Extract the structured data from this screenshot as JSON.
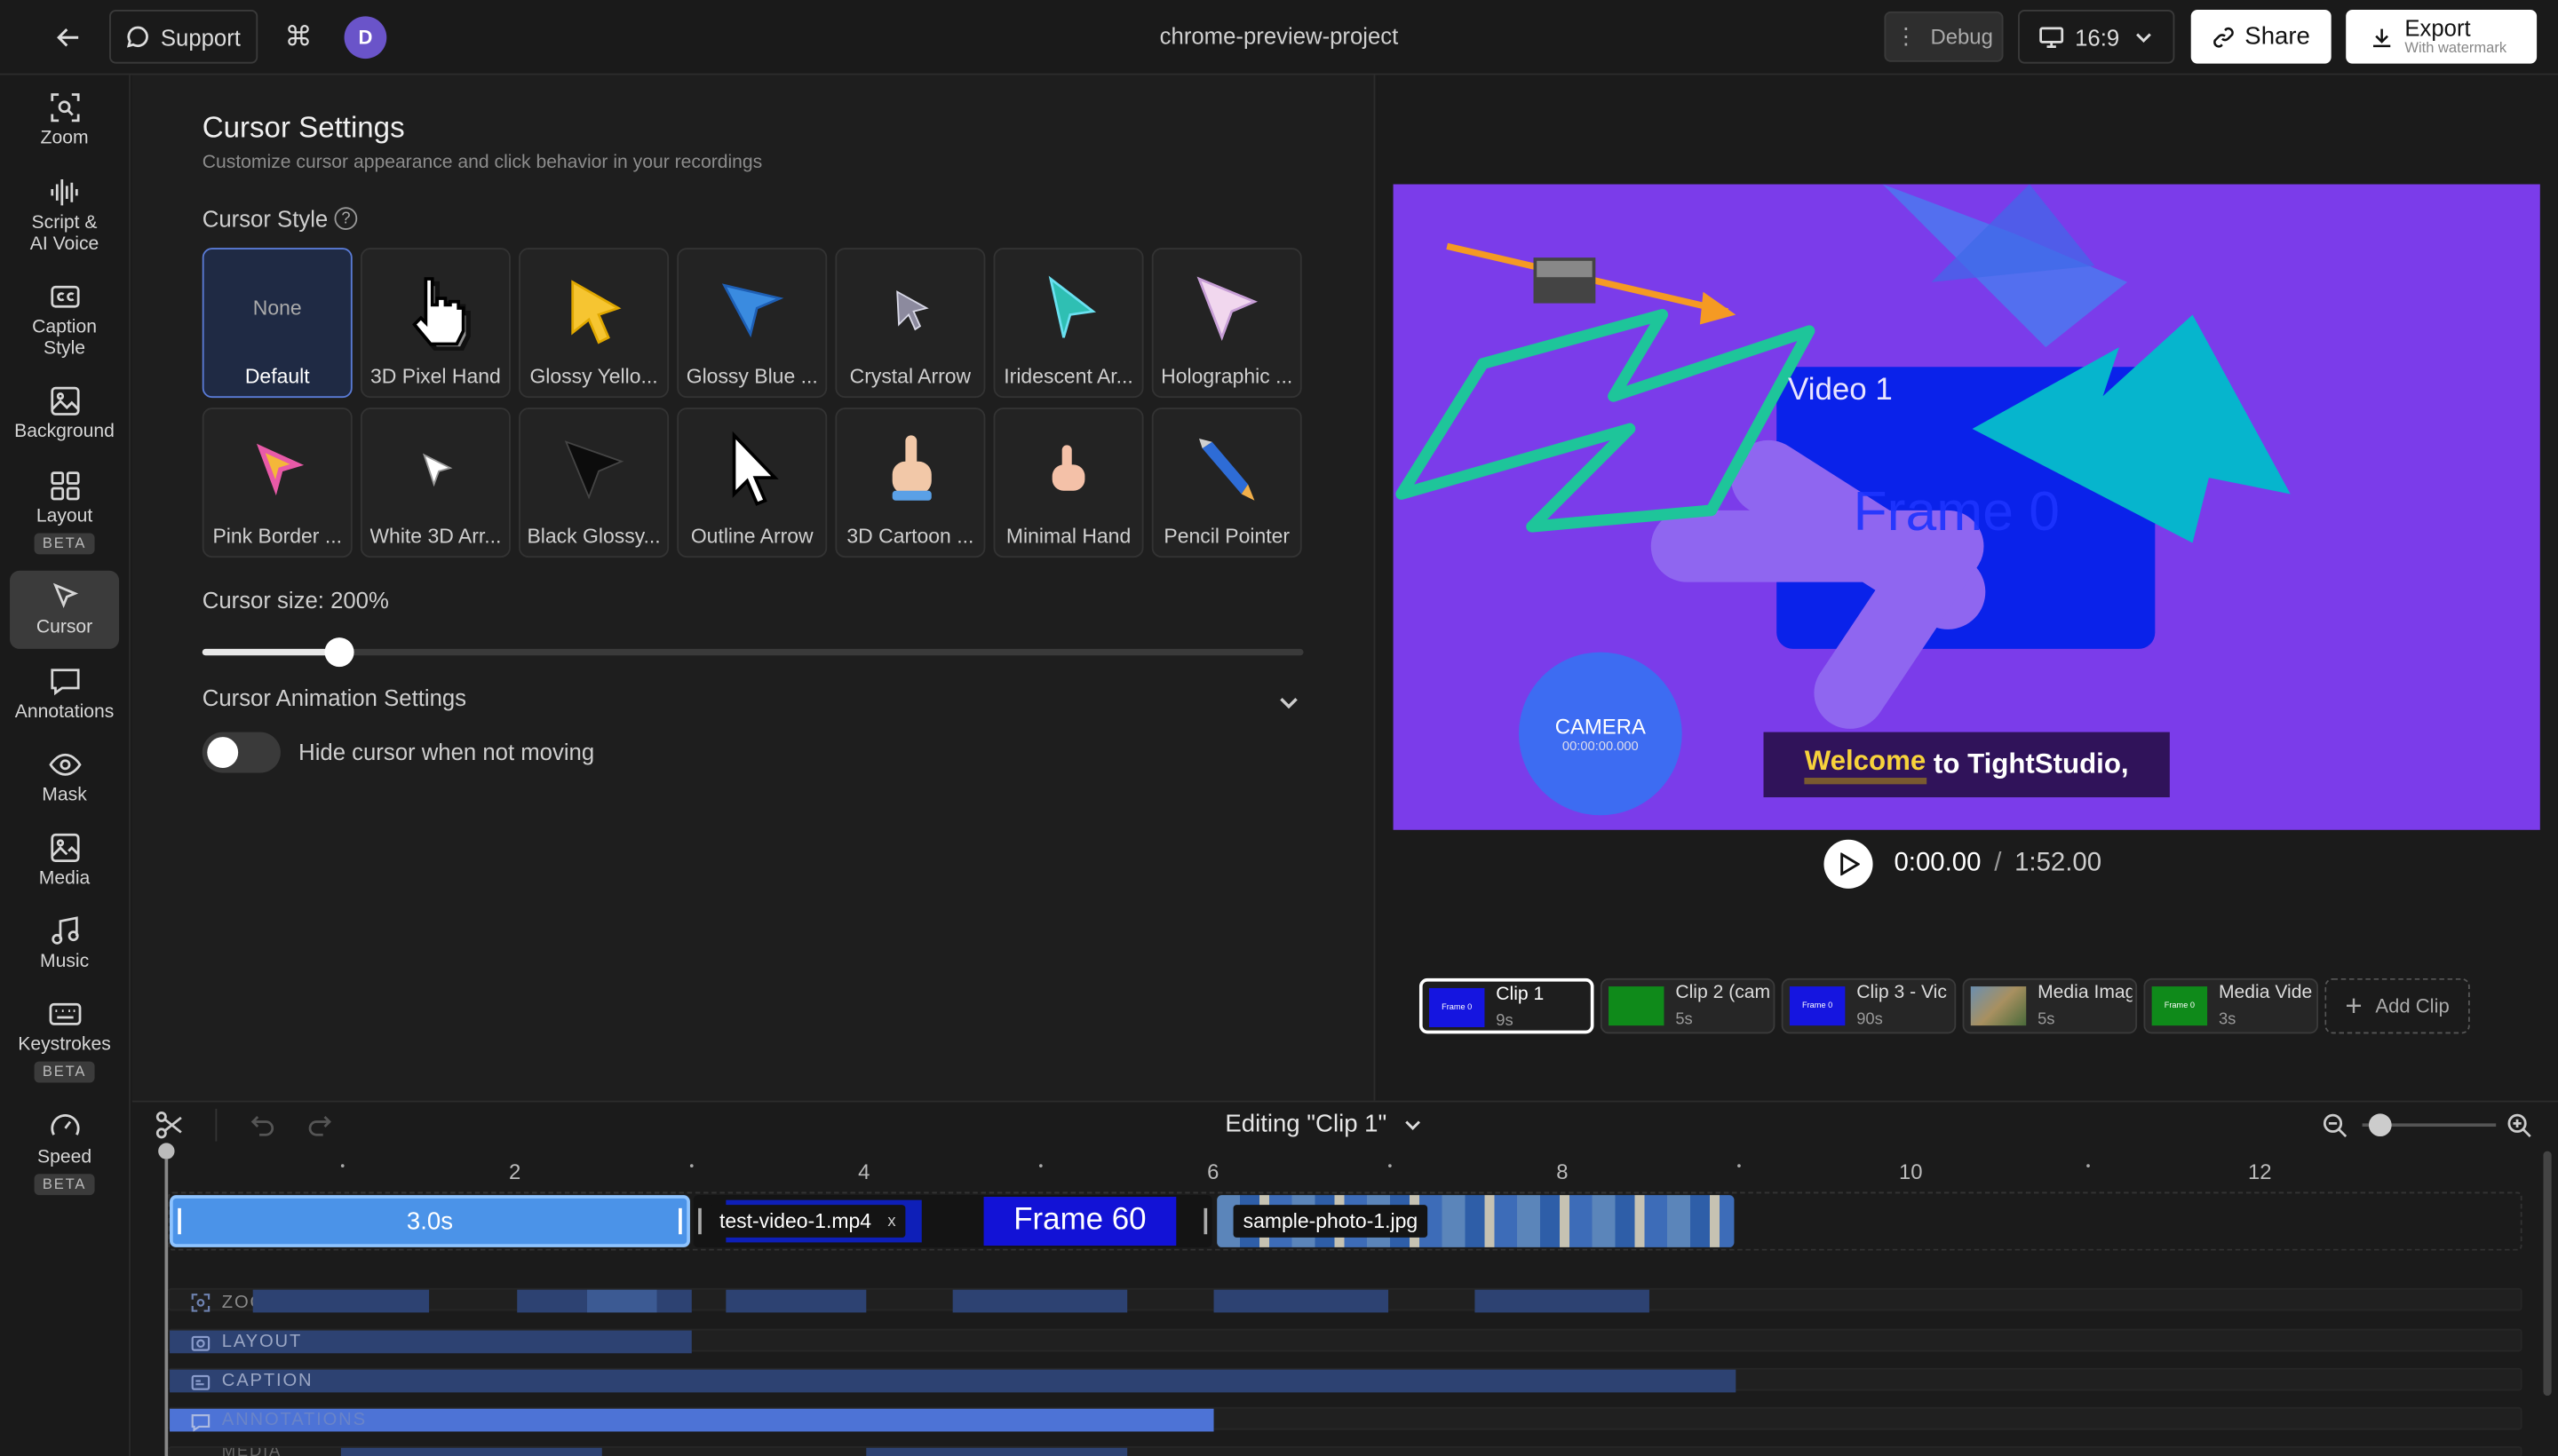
{
  "topbar": {
    "support_label": "Support",
    "avatar_initial": "D",
    "project_title": "chrome-preview-project",
    "debug_label": "Debug",
    "aspect_label": "16:9",
    "share_label": "Share",
    "export_label": "Export",
    "export_sub": "With watermark"
  },
  "sidebar": {
    "items": [
      {
        "label": "Zoom",
        "icon": "zoom-icon"
      },
      {
        "label": "Script &\nAI Voice",
        "icon": "waveform-icon"
      },
      {
        "label": "Caption\nStyle",
        "icon": "cc-icon"
      },
      {
        "label": "Background",
        "icon": "image-icon"
      },
      {
        "label": "Layout",
        "icon": "grid-icon",
        "badge": "BETA"
      },
      {
        "label": "Cursor",
        "icon": "cursor-icon",
        "active": true
      },
      {
        "label": "Annotations",
        "icon": "comment-icon"
      },
      {
        "label": "Mask",
        "icon": "eye-icon"
      },
      {
        "label": "Media",
        "icon": "media-icon"
      },
      {
        "label": "Music",
        "icon": "music-icon"
      },
      {
        "label": "Keystrokes",
        "icon": "keyboard-icon",
        "badge": "BETA"
      },
      {
        "label": "Speed",
        "icon": "gauge-icon",
        "badge": "BETA"
      }
    ]
  },
  "settings": {
    "title": "Cursor Settings",
    "subtitle": "Customize cursor appearance and click behavior in your recordings",
    "style_label": "Cursor Style",
    "cursors": [
      {
        "label": "Default",
        "top": "None",
        "selected": true
      },
      {
        "label": "3D Pixel Hand"
      },
      {
        "label": "Glossy Yello..."
      },
      {
        "label": "Glossy Blue ..."
      },
      {
        "label": "Crystal Arrow"
      },
      {
        "label": "Iridescent Ar..."
      },
      {
        "label": "Holographic ..."
      },
      {
        "label": "Pink Border ..."
      },
      {
        "label": "White 3D Arr..."
      },
      {
        "label": "Black Glossy..."
      },
      {
        "label": "Outline Arrow"
      },
      {
        "label": "3D Cartoon ..."
      },
      {
        "label": "Minimal Hand"
      },
      {
        "label": "Pencil Pointer"
      }
    ],
    "size_label": "Cursor size: 200%",
    "size_fraction": 0.125,
    "animation_label": "Cursor Animation Settings",
    "hide_toggle_label": "Hide cursor when not moving",
    "hide_toggle_on": false
  },
  "preview": {
    "video_label": "Video 1",
    "frame_text": "Frame 0",
    "camera_label": "CAMERA",
    "camera_time": "00:00:00.000",
    "caption_highlight": "Welcome",
    "caption_rest": " to TightStudio,",
    "time_current": "0:00.00",
    "time_sep": "/",
    "time_total": "1:52.00"
  },
  "clips": [
    {
      "name": "Clip 1",
      "duration": "9s",
      "thumb": "Frame 0",
      "selected": true
    },
    {
      "name": "Clip 2 (cam",
      "duration": "5s",
      "thumb": "green"
    },
    {
      "name": "Clip 3 - Vic",
      "duration": "90s",
      "thumb": "Frame 0"
    },
    {
      "name": "Media Imag",
      "duration": "5s",
      "thumb": "photo"
    },
    {
      "name": "Media Vide",
      "duration": "3s",
      "thumb": "Frame 0"
    }
  ],
  "add_clip_label": "Add Clip",
  "timeline": {
    "editing_label": "Editing \"Clip 1\"",
    "ticks": [
      "2",
      "4",
      "6",
      "8",
      "10",
      "12"
    ],
    "clip_duration_label": "3.0s",
    "video_clip_label": "test-video-1.mp4",
    "video_clip_close": "x",
    "frame_label": "Frame 60",
    "photo_clip_label": "sample-photo-1.jpg",
    "tracks": [
      "ZOOM",
      "LAYOUT",
      "CAPTION",
      "ANNOTATIONS",
      "MEDIA"
    ],
    "zoom_fraction": 0.05
  }
}
